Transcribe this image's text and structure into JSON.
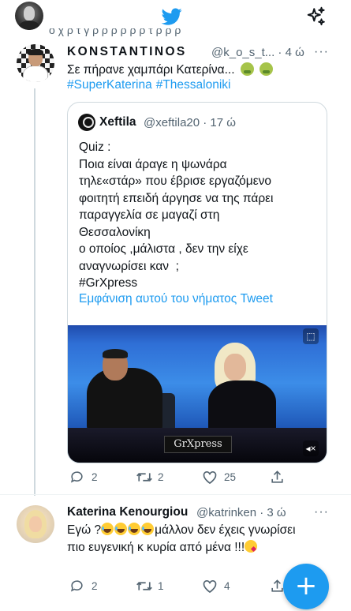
{
  "top_cutoff_text": "ο χ ρ τ γ ρ ρ ρ ρ ρ ρ τ ρ ρ ρ",
  "tweet1": {
    "display_name": "KONSTANTINOS",
    "handle_time": "@k_o_s_t... · 4 ώ",
    "text": "Σε πήρανε χαμπάρι Κατερίνα...",
    "hashtags": [
      "#SuperKaterina",
      "#Thessaloniki"
    ],
    "quote": {
      "display_name": "Xeftila",
      "handle_time": "@xeftila20 · 17 ώ",
      "lines": [
        "Quiz :",
        "Ποια είναι άραγε η ψωνάρα",
        "τηλε«στάρ» που έβρισε εργαζόμενο",
        "φοιτητή επειδή άργησε να της πάρει",
        "παραγγελία σε μαγαζί στη",
        "Θεσσαλονίκη",
        "ο οποίος ,μάλιστα , δεν την είχε",
        "αναγνωρίσει καν  ;",
        "#GrXpress"
      ],
      "show_thread": "Εμφάνιση αυτού του νήματος Tweet",
      "video_logo": "GrXpress"
    },
    "actions": {
      "replies": "2",
      "retweets": "2",
      "likes": "25"
    }
  },
  "tweet2": {
    "display_name": "Katerina Kenourgiou",
    "handle_time": "@katrinken · 3 ώ",
    "text_part1": "Εγώ ?",
    "text_part2": "μάλλον δεν έχεις γνωρίσει πιο ευγενική κ κυρία από μένα !!!",
    "actions": {
      "replies": "2",
      "retweets": "1",
      "likes": "4"
    }
  },
  "icons": {
    "logo": "twitter-bird-icon",
    "top_right": "sparkle-icon",
    "fab": "compose-plus-icon"
  },
  "colors": {
    "accent": "#1d9bf0",
    "muted": "#536471",
    "text": "#0f1419"
  },
  "fab_label": "+"
}
